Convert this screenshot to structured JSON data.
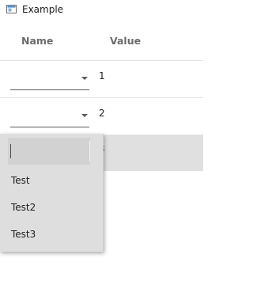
{
  "window": {
    "title": "Example",
    "icon": "app-window-icon"
  },
  "table": {
    "columns": {
      "name": "Name",
      "value": "Value"
    },
    "rows": [
      {
        "value": "1",
        "selected": false
      },
      {
        "value": "2",
        "selected": false
      },
      {
        "value": "3",
        "selected": true
      }
    ]
  },
  "dropdown": {
    "input_value": "",
    "options": [
      "Test",
      "Test2",
      "Test3"
    ]
  }
}
